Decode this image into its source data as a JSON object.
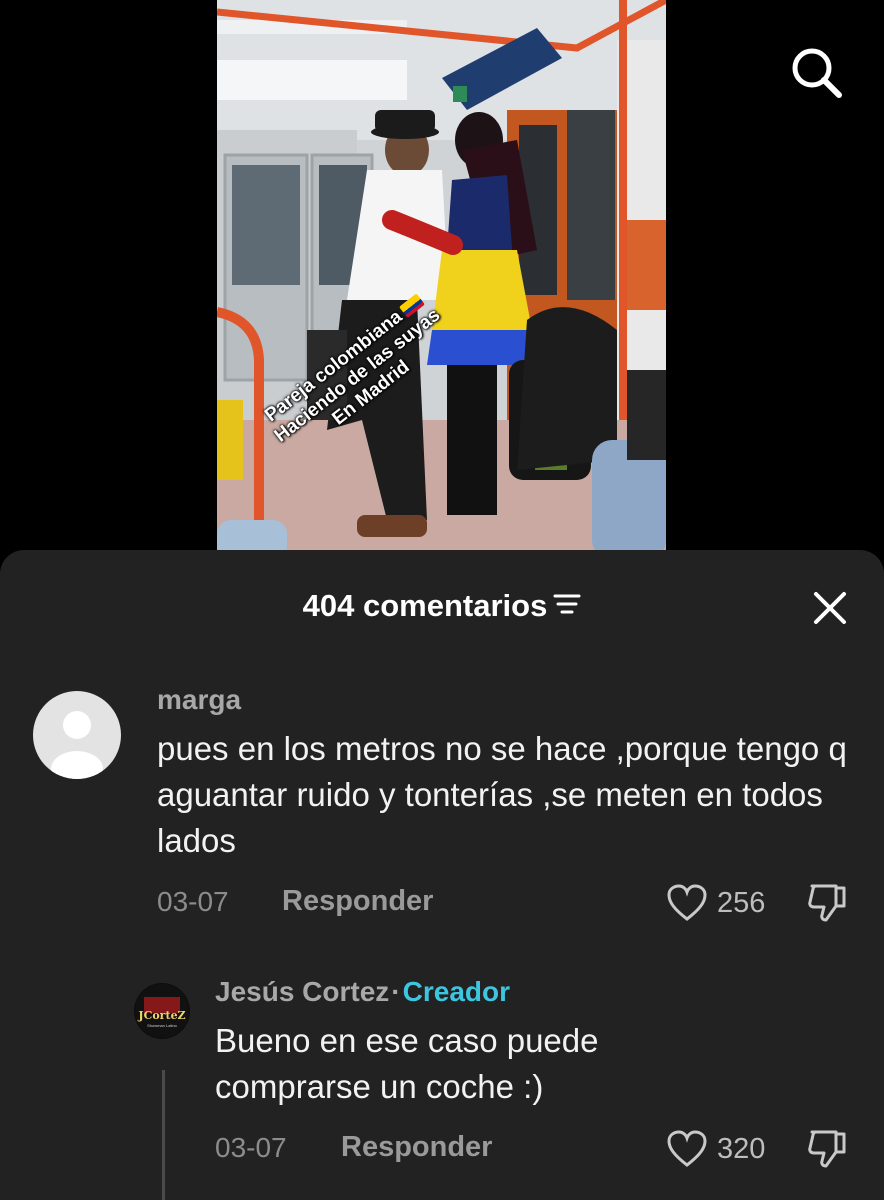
{
  "video": {
    "overlay_lines": [
      "Pareja colombiana",
      "Haciendo de las suyas",
      "En Madrid"
    ]
  },
  "icons": {
    "search": "search-icon",
    "filter": "filter-icon",
    "close": "close-icon",
    "like": "heart-icon",
    "dislike": "thumbs-down-icon"
  },
  "comments_header": {
    "title": "404 comentarios"
  },
  "comments": [
    {
      "username": "marga",
      "text": "pues en los metros no se hace ,porque tengo q aguantar ruido y tonterías ,se meten en todos lados",
      "date": "03-07",
      "reply_label": "Responder",
      "likes": "256"
    }
  ],
  "replies": [
    {
      "username": "Jesús Cortez",
      "separator": "·",
      "badge": "Creador",
      "avatar_text": "JCorteZ",
      "avatar_subtext": "Showman Latino",
      "text": "Bueno en ese caso puede comprarse un coche :)",
      "date": "03-07",
      "reply_label": "Responder",
      "likes": "320"
    }
  ],
  "colors": {
    "sheet_bg": "#222223",
    "creator_badge": "#3cc6e0",
    "background": "#000000"
  }
}
